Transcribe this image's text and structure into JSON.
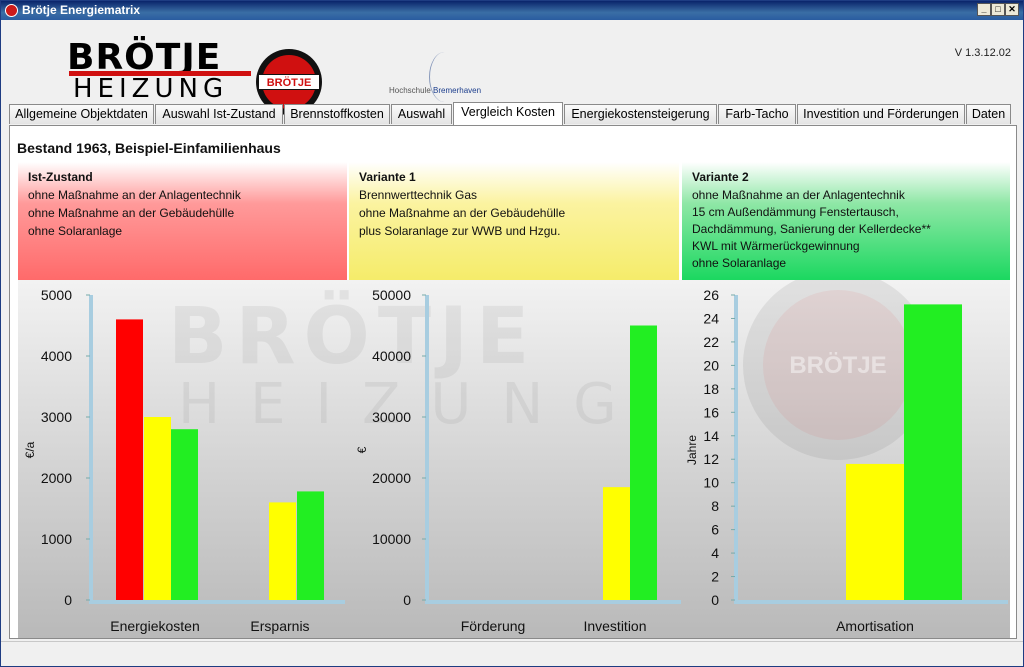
{
  "window": {
    "title": "Brötje Energiematrix",
    "controls": [
      "_",
      "□",
      "✕"
    ]
  },
  "header": {
    "logo_line1": "BRÖTJE",
    "logo_line2": "HEIZUNG",
    "logo_badge": "BRÖTJE",
    "partner_prefix": "Hochschule ",
    "partner_name": "Bremerhaven",
    "version": "V 1.3.12.02"
  },
  "tabs": [
    {
      "label": "Allgemeine Objektdaten",
      "active": false
    },
    {
      "label": "Auswahl Ist-Zustand",
      "active": false
    },
    {
      "label": "Brennstoffkosten",
      "active": false
    },
    {
      "label": "Auswahl",
      "active": false
    },
    {
      "label": "Vergleich Kosten",
      "active": true
    },
    {
      "label": "Energiekostensteigerung",
      "active": false
    },
    {
      "label": "Farb-Tacho",
      "active": false
    },
    {
      "label": "Investition und Förderungen",
      "active": false
    },
    {
      "label": "Daten",
      "active": false
    }
  ],
  "panel": {
    "title": "Bestand 1963, Beispiel-Einfamilienhaus",
    "cards": [
      {
        "title": "Ist-Zustand",
        "lines": [
          "ohne Maßnahme an der Anlagentechnik",
          "ohne Maßnahme an der Gebäudehülle",
          "ohne Solaranlage"
        ]
      },
      {
        "title": "Variante 1",
        "lines": [
          "Brennwerttechnik Gas",
          "ohne Maßnahme an der Gebäudehülle",
          "plus Solaranlage zur WWB und Hzgu."
        ]
      },
      {
        "title": "Variante 2",
        "lines": [
          "ohne Maßnahme an der Anlagentechnik",
          "15 cm Außendämmung Fenstertausch,",
          "Dachdämmung, Sanierung der Kellerdecke**",
          "KWL mit Wärmerückgewinnung",
          "ohne Solaranlage"
        ]
      }
    ],
    "watermark": {
      "line1": "BRÖTJE",
      "line2": "HEIZUNG",
      "badge": "BRÖTJE"
    }
  },
  "colors": {
    "ist": "#ff0000",
    "variante1": "#ffff00",
    "variante2": "#22ee22",
    "axis": "#a8cde0"
  },
  "chart_data": [
    {
      "type": "bar",
      "ylabel": "€/a",
      "ylim": [
        0,
        5000
      ],
      "yticks": [
        0,
        1000,
        2000,
        3000,
        4000,
        5000
      ],
      "categories": [
        "Energiekosten",
        "Ersparnis"
      ],
      "series": [
        {
          "values": [
            4600,
            null
          ]
        },
        {
          "values": [
            3000,
            1600
          ]
        },
        {
          "values": [
            2800,
            1780
          ]
        }
      ]
    },
    {
      "type": "bar",
      "ylabel": "€",
      "ylim": [
        0,
        50000
      ],
      "yticks": [
        0,
        10000,
        20000,
        30000,
        40000,
        50000
      ],
      "categories": [
        "Förderung",
        "Investition"
      ],
      "series": [
        {
          "values": [
            null,
            null
          ]
        },
        {
          "values": [
            0,
            18500
          ]
        },
        {
          "values": [
            0,
            45000
          ]
        }
      ]
    },
    {
      "type": "bar",
      "ylabel": "Jahre",
      "ylim": [
        0,
        26
      ],
      "yticks": [
        0,
        2,
        4,
        6,
        8,
        10,
        12,
        14,
        16,
        18,
        20,
        22,
        24,
        26
      ],
      "categories": [
        "Amortisation"
      ],
      "series": [
        {
          "values": [
            null
          ]
        },
        {
          "values": [
            11.6
          ]
        },
        {
          "values": [
            25.2
          ]
        }
      ]
    }
  ]
}
